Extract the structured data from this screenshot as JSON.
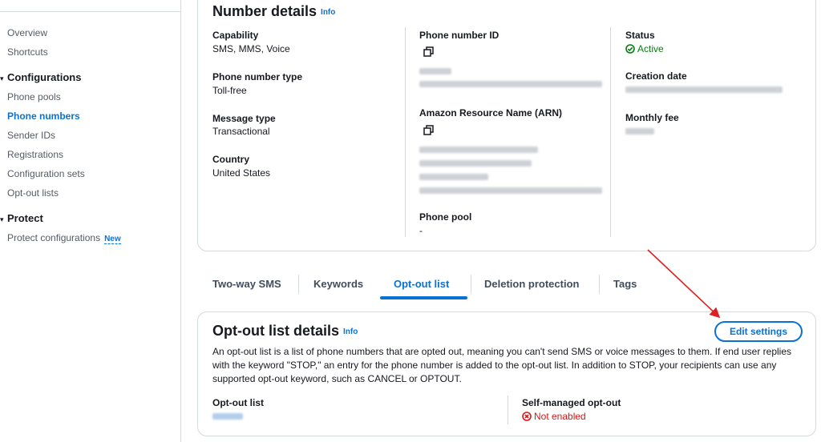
{
  "sidebar": {
    "items_top": [
      "Overview",
      "Shortcuts"
    ],
    "configurations": {
      "title": "Configurations",
      "items": [
        "Phone pools",
        "Phone numbers",
        "Sender IDs",
        "Registrations",
        "Configuration sets",
        "Opt-out lists"
      ]
    },
    "protect": {
      "title": "Protect",
      "item": "Protect configurations",
      "badge": "New"
    }
  },
  "number_details": {
    "title": "Number details",
    "info": "Info",
    "capability": {
      "label": "Capability",
      "value": "SMS, MMS, Voice"
    },
    "phone_number_type": {
      "label": "Phone number type",
      "value": "Toll-free"
    },
    "message_type": {
      "label": "Message type",
      "value": "Transactional"
    },
    "country": {
      "label": "Country",
      "value": "United States"
    },
    "phone_number_id": {
      "label": "Phone number ID"
    },
    "arn": {
      "label": "Amazon Resource Name (ARN)"
    },
    "phone_pool": {
      "label": "Phone pool",
      "value": "-"
    },
    "status": {
      "label": "Status",
      "value": "Active"
    },
    "creation_date": {
      "label": "Creation date"
    },
    "monthly_fee": {
      "label": "Monthly fee"
    }
  },
  "tabs": [
    "Two-way SMS",
    "Keywords",
    "Opt-out list",
    "Deletion protection",
    "Tags"
  ],
  "active_tab": "Opt-out list",
  "optout": {
    "title": "Opt-out list details",
    "info": "Info",
    "edit_button": "Edit settings",
    "description": "An opt-out list is a list of phone numbers that are opted out, meaning you can't send SMS or voice messages to them. If end user replies with the keyword \"STOP,\" an entry for the phone number is added to the opt-out list. In addition to STOP, your recipients can use any supported opt-out keyword, such as CANCEL or OPTOUT.",
    "optout_list": {
      "label": "Opt-out list"
    },
    "self_managed": {
      "label": "Self-managed opt-out",
      "value": "Not enabled"
    }
  },
  "colors": {
    "link": "#0972d3",
    "success": "#037f0c",
    "error": "#d91515",
    "annotation_arrow": "#e02020"
  }
}
